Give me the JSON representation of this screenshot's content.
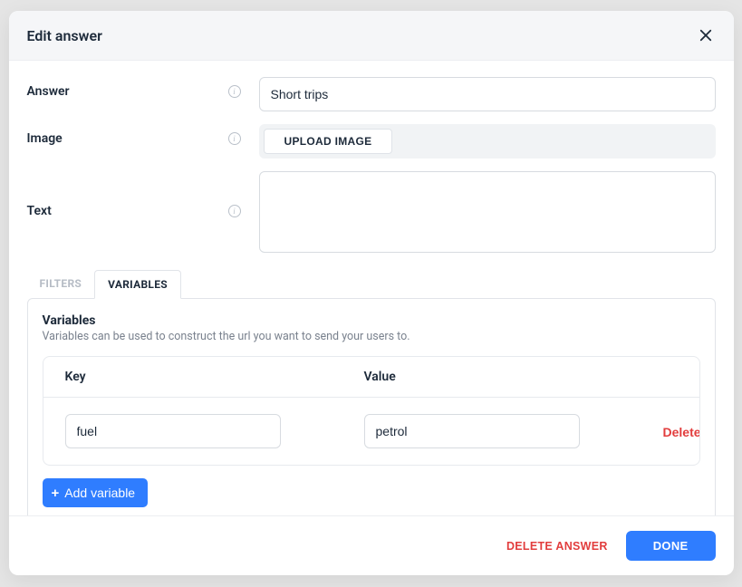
{
  "modal": {
    "title": "Edit answer"
  },
  "fields": {
    "answer": {
      "label": "Answer",
      "value": "Short trips"
    },
    "image": {
      "label": "Image",
      "upload_label": "UPLOAD IMAGE"
    },
    "text": {
      "label": "Text",
      "value": ""
    }
  },
  "tabs": {
    "filters": "FILTERS",
    "variables": "VARIABLES"
  },
  "variables_panel": {
    "heading": "Variables",
    "subtext": "Variables can be used to construct the url you want to send your users to.",
    "columns": {
      "key": "Key",
      "value": "Value"
    },
    "rows": [
      {
        "key": "fuel",
        "value": "petrol"
      }
    ],
    "delete_label": "Delete",
    "add_label": "Add variable"
  },
  "footer": {
    "delete_answer": "DELETE ANSWER",
    "done": "DONE"
  }
}
